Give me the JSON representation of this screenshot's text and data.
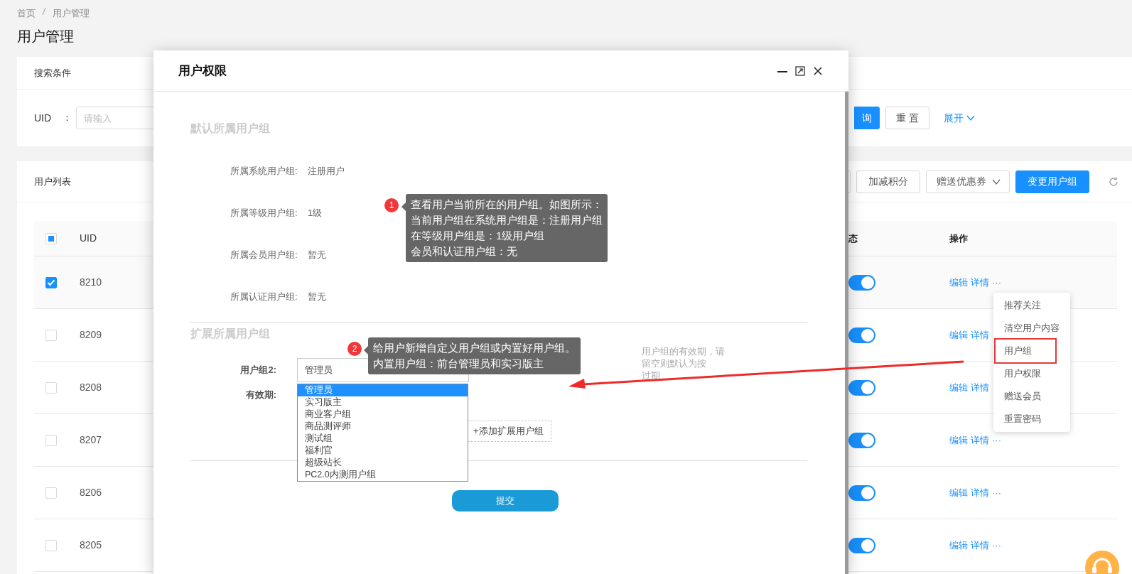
{
  "breadcrumb": [
    "首页",
    "用户管理"
  ],
  "page_title": "用户管理",
  "search_panel": {
    "title": "搜索条件",
    "field_label": "UID",
    "field_colon": "：",
    "placeholder": "请输入",
    "buttons": [
      {
        "label": "询",
        "kind": "primary"
      },
      {
        "label": "重 置",
        "kind": "default"
      }
    ],
    "expand_link": "展开"
  },
  "user_list": {
    "title": "用户列表",
    "toolbar": [
      {
        "kind": "blank"
      },
      {
        "kind": "default",
        "label": "加减积分"
      },
      {
        "kind": "dropdown",
        "label": "赠送优惠券"
      },
      {
        "kind": "primary",
        "label": "变更用户组"
      }
    ],
    "select_all_partial": true,
    "columns": [
      "UID",
      "态",
      "操作"
    ],
    "rows": [
      {
        "uid": "8210",
        "checked": true,
        "enabled": true,
        "actions": [
          "编辑",
          "详情",
          "···"
        ]
      },
      {
        "uid": "8209",
        "checked": false,
        "enabled": true,
        "actions": [
          "编辑",
          "详情"
        ]
      },
      {
        "uid": "8208",
        "checked": false,
        "enabled": true,
        "actions": [
          "编辑",
          "详情"
        ]
      },
      {
        "uid": "8207",
        "checked": false,
        "enabled": true,
        "actions": [
          "编辑",
          "详情",
          "···"
        ]
      },
      {
        "uid": "8206",
        "checked": false,
        "enabled": true,
        "actions": [
          "编辑",
          "详情",
          "···"
        ]
      },
      {
        "uid": "8205",
        "checked": false,
        "enabled": true,
        "actions": [
          "编辑",
          "详情",
          "···"
        ]
      }
    ],
    "row_menu": [
      {
        "label": "推荐关注",
        "highlighted": false
      },
      {
        "label": "清空用户内容",
        "highlighted": false
      },
      {
        "label": "用户组",
        "highlighted": true
      },
      {
        "label": "用户权限",
        "highlighted": false
      },
      {
        "label": "赠送会员",
        "highlighted": false
      },
      {
        "label": "重置密码",
        "highlighted": false
      }
    ]
  },
  "modal": {
    "title": "用户权限",
    "default_section": {
      "title": "默认所属用户组",
      "rows": [
        {
          "label": "所属系统用户组:",
          "value": "注册用户"
        },
        {
          "label": "所属等级用户组:",
          "value": "1级"
        },
        {
          "label": "所属会员用户组:",
          "value": "暂无"
        },
        {
          "label": "所属认证用户组:",
          "value": "暂无"
        }
      ]
    },
    "extended_section": {
      "title": "扩展所属用户组",
      "group_label": "用户组2:",
      "group_value": "管理员",
      "options": [
        {
          "label": "管理员",
          "selected": true
        },
        {
          "label": "实习版主",
          "selected": false
        },
        {
          "label": "商业客户组",
          "selected": false
        },
        {
          "label": "商品测评师",
          "selected": false
        },
        {
          "label": "测试组",
          "selected": false
        },
        {
          "label": "福利官",
          "selected": false
        },
        {
          "label": "超级站长",
          "selected": false
        },
        {
          "label": "PC2.0内测用户组",
          "selected": false
        }
      ],
      "expiry_label": "有效期:",
      "hint_lines": [
        "用户组的有效期，请",
        "留空则默认为按",
        "过期"
      ],
      "add_button": "+添加扩展用户组"
    },
    "submit": "提交"
  },
  "annotations": [
    {
      "number": "1",
      "lines": [
        "查看用户当前所在的用户组。如图所示：",
        "当前用户组在系统用户组是：注册用户组",
        "在等级用户组是：1级用户组",
        "会员和认证用户组：无"
      ]
    },
    {
      "number": "2",
      "lines": [
        "给用户新增自定义用户组或内置好用户组。",
        "内置用户组：前台管理员和实习版主"
      ]
    }
  ]
}
